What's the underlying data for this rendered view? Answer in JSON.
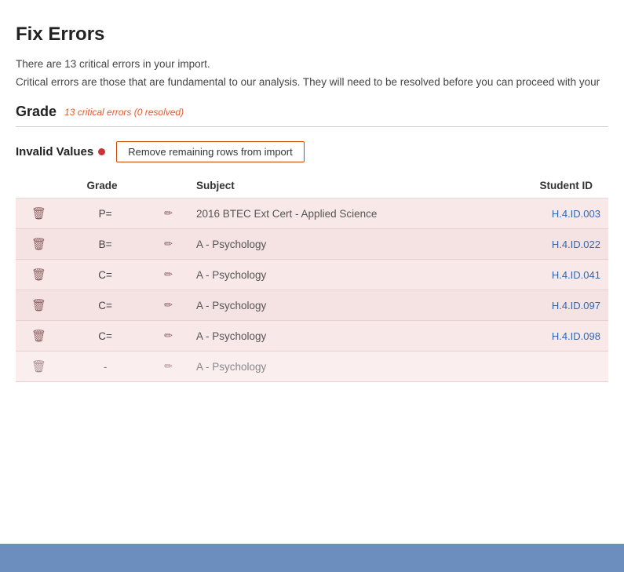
{
  "page": {
    "title": "Fix Errors",
    "description1": "There are 13 critical errors in your import.",
    "description2": "Critical errors are those that are fundamental to our analysis. They will need to be resolved before you can proceed with your",
    "section": {
      "title": "Grade",
      "errors_label": "13 critical errors (0 resolved)"
    },
    "invalid_values_label": "Invalid Values",
    "remove_btn_label": "Remove remaining rows from import",
    "table": {
      "headers": {
        "grade": "Grade",
        "subject": "Subject",
        "student_id": "Student ID"
      },
      "rows": [
        {
          "grade": "P=",
          "subject": "2016 BTEC Ext Cert - Applied Science",
          "student_id": "H.4.ID.003"
        },
        {
          "grade": "B=",
          "subject": "A - Psychology",
          "student_id": "H.4.ID.022"
        },
        {
          "grade": "C=",
          "subject": "A - Psychology",
          "student_id": "H.4.ID.041"
        },
        {
          "grade": "C=",
          "subject": "A - Psychology",
          "student_id": "H.4.ID.097"
        },
        {
          "grade": "C=",
          "subject": "A - Psychology",
          "student_id": "H.4.ID.098"
        },
        {
          "grade": "-",
          "subject": "A - Psychology",
          "student_id": ""
        }
      ]
    }
  }
}
